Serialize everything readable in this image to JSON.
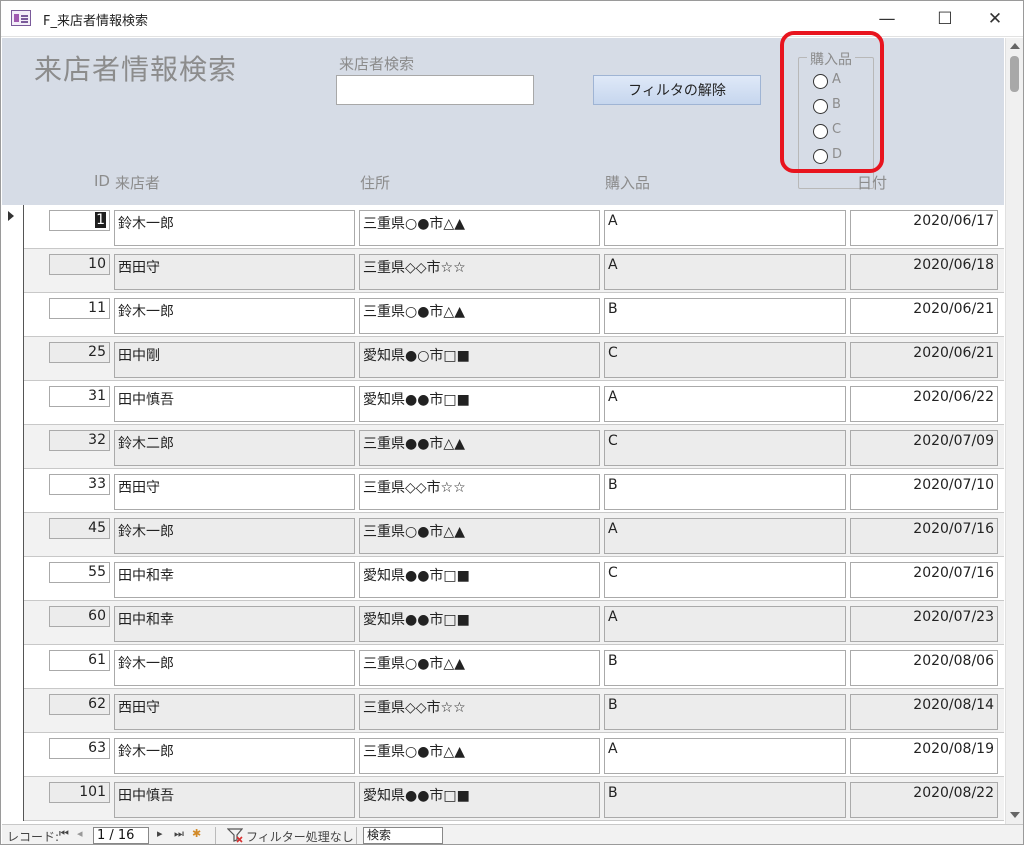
{
  "window": {
    "title": "F_来店者情報検索",
    "min_glyph": "—",
    "max_glyph": "☐",
    "close_glyph": "✕"
  },
  "header": {
    "title": "来店者情報検索",
    "search_label": "来店者検索",
    "search_value": "",
    "filter_button_label": "フィルタの解除",
    "option_group": {
      "legend": "購入品",
      "options": [
        "A",
        "B",
        "C",
        "D"
      ]
    },
    "highlight_color": "#e8141e"
  },
  "columns": {
    "id": "ID",
    "name": "来店者",
    "address": "住所",
    "item": "購入品",
    "date": "日付"
  },
  "records": [
    {
      "id": "1",
      "name": "鈴木一郎",
      "address": "三重県○●市△▲",
      "item": "A",
      "date": "2020/06/17",
      "current": true
    },
    {
      "id": "10",
      "name": "西田守",
      "address": "三重県◇◇市☆☆",
      "item": "A",
      "date": "2020/06/18"
    },
    {
      "id": "11",
      "name": "鈴木一郎",
      "address": "三重県○●市△▲",
      "item": "B",
      "date": "2020/06/21"
    },
    {
      "id": "25",
      "name": "田中剛",
      "address": "愛知県●○市□■",
      "item": "C",
      "date": "2020/06/21"
    },
    {
      "id": "31",
      "name": "田中慎吾",
      "address": "愛知県●●市□■",
      "item": "A",
      "date": "2020/06/22"
    },
    {
      "id": "32",
      "name": "鈴木二郎",
      "address": "三重県●●市△▲",
      "item": "C",
      "date": "2020/07/09"
    },
    {
      "id": "33",
      "name": "西田守",
      "address": "三重県◇◇市☆☆",
      "item": "B",
      "date": "2020/07/10"
    },
    {
      "id": "45",
      "name": "鈴木一郎",
      "address": "三重県○●市△▲",
      "item": "A",
      "date": "2020/07/16"
    },
    {
      "id": "55",
      "name": "田中和幸",
      "address": "愛知県●●市□■",
      "item": "C",
      "date": "2020/07/16"
    },
    {
      "id": "60",
      "name": "田中和幸",
      "address": "愛知県●●市□■",
      "item": "A",
      "date": "2020/07/23"
    },
    {
      "id": "61",
      "name": "鈴木一郎",
      "address": "三重県○●市△▲",
      "item": "B",
      "date": "2020/08/06"
    },
    {
      "id": "62",
      "name": "西田守",
      "address": "三重県◇◇市☆☆",
      "item": "B",
      "date": "2020/08/14"
    },
    {
      "id": "63",
      "name": "鈴木一郎",
      "address": "三重県○●市△▲",
      "item": "A",
      "date": "2020/08/19"
    },
    {
      "id": "101",
      "name": "田中慎吾",
      "address": "愛知県●●市□■",
      "item": "B",
      "date": "2020/08/22"
    }
  ],
  "navigation": {
    "label": "レコード:",
    "first_glyph": "⏮",
    "prev_glyph": "◂",
    "position": "1 / 16",
    "next_glyph": "▸",
    "last_glyph": "⏭",
    "new_glyph": "✱",
    "filter_status": "フィルター処理なし",
    "search_label": "検索"
  }
}
